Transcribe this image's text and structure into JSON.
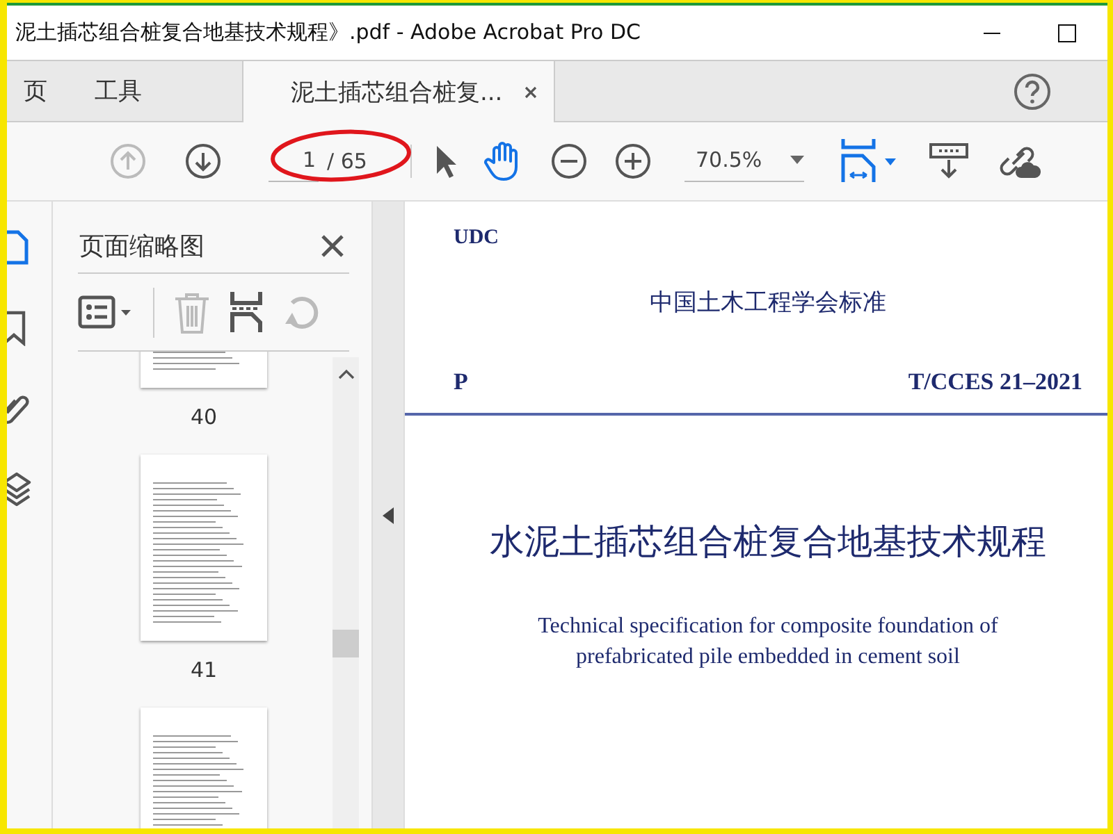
{
  "window": {
    "title": "泥土插芯组合桩复合地基技术规程》.pdf - Adobe Acrobat Pro DC"
  },
  "tabs": [
    {
      "label": "页",
      "selected": false
    },
    {
      "label": "工具",
      "selected": false
    },
    {
      "label": "泥土插芯组合桩复...",
      "selected": true
    }
  ],
  "toolbar": {
    "page_field": {
      "value": "1"
    },
    "page_total": "/ 65",
    "zoom": "70.5%"
  },
  "rail": [
    {
      "kind": "pages",
      "selected": true
    },
    {
      "kind": "bookmark",
      "selected": false
    },
    {
      "kind": "attachment",
      "selected": false
    },
    {
      "kind": "layers",
      "selected": false
    }
  ],
  "sidebar": {
    "title": "页面缩略图",
    "thumbnails": [
      {
        "kind": "page",
        "label": "40"
      },
      {
        "kind": "page",
        "label": "41"
      },
      {
        "kind": "page"
      }
    ]
  },
  "document": {
    "udc": "UDC",
    "org": "中国土木工程学会标准",
    "class_code": "P",
    "standard_no": "T/CCES 21–2021",
    "title_cn": "水泥土插芯组合桩复合地基技术规程",
    "title_en": [
      "Technical specification for composite foundation of",
      "prefabricated pile embedded in cement soil"
    ]
  }
}
